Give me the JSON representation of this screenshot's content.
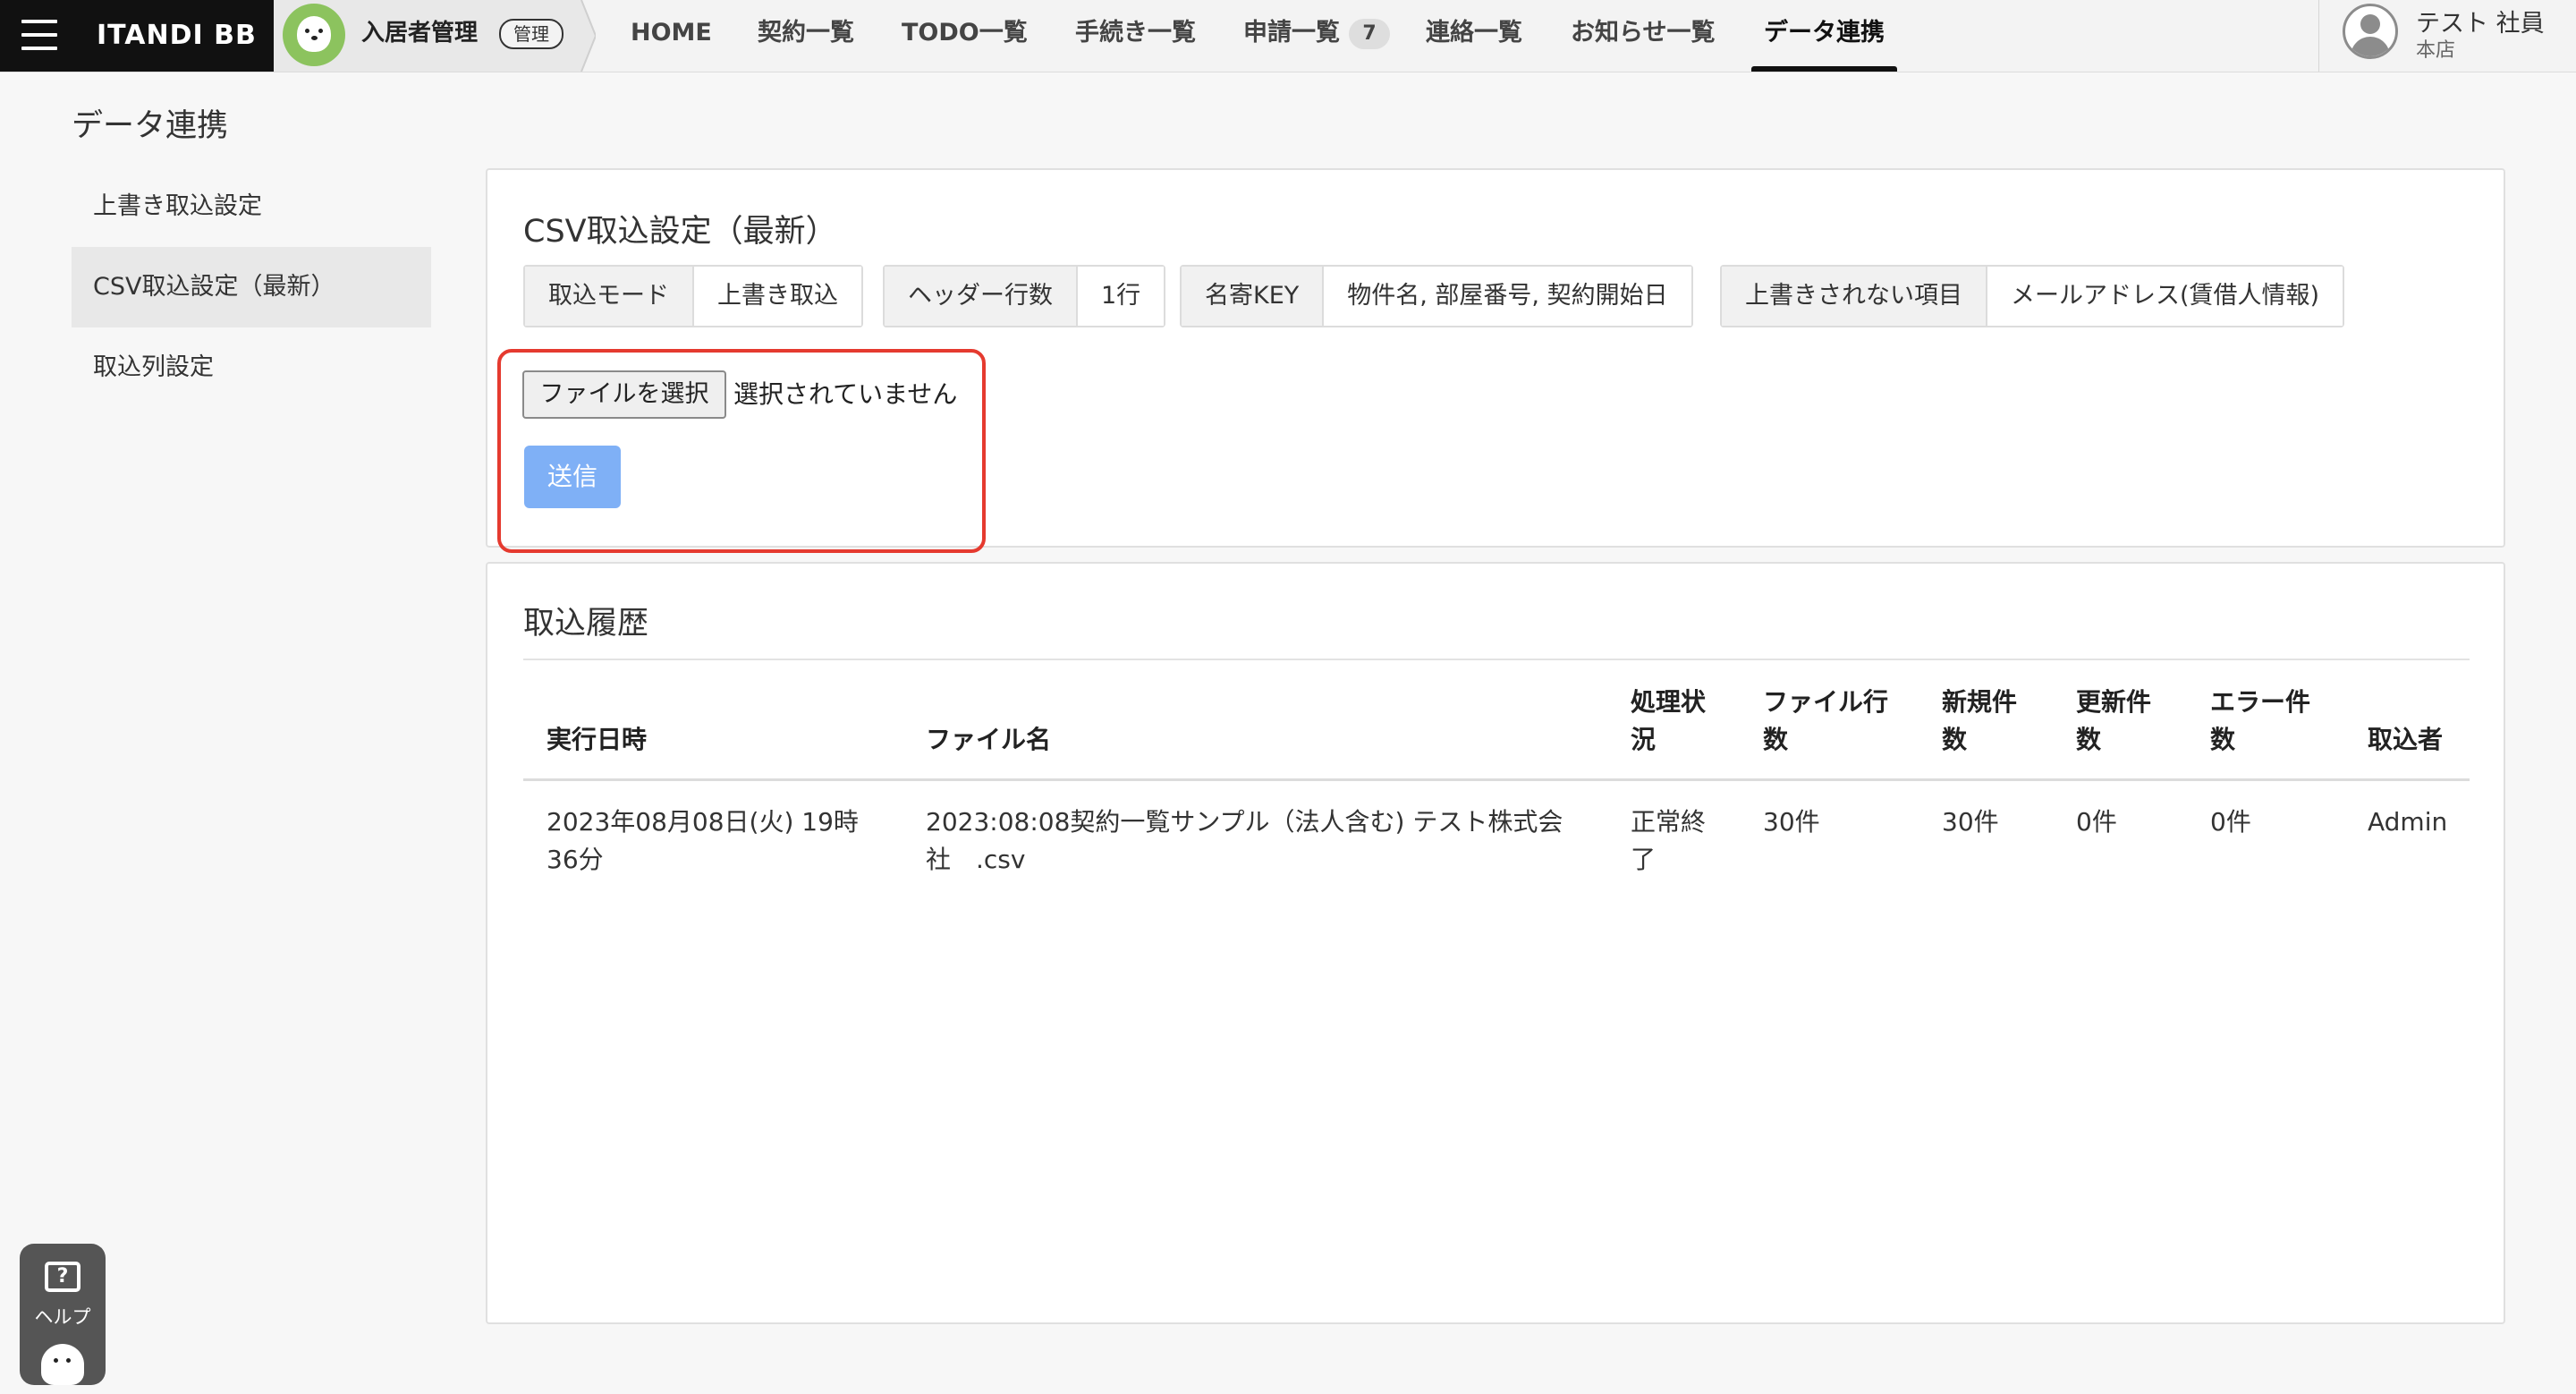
{
  "header": {
    "brand": "ITANDI BB",
    "product": {
      "name": "入居者管理",
      "badge": "管理"
    },
    "nav": [
      {
        "label": "HOME"
      },
      {
        "label": "契約一覧"
      },
      {
        "label": "TODO一覧"
      },
      {
        "label": "手続き一覧"
      },
      {
        "label": "申請一覧",
        "count": "7"
      },
      {
        "label": "連絡一覧"
      },
      {
        "label": "お知らせ一覧"
      },
      {
        "label": "データ連携",
        "active": true
      }
    ],
    "user": {
      "name": "テスト 社員",
      "branch": "本店"
    }
  },
  "page": {
    "title": "データ連携"
  },
  "sidebar": {
    "items": [
      {
        "label": "上書き取込設定"
      },
      {
        "label": "CSV取込設定（最新）",
        "active": true
      },
      {
        "label": "取込列設定"
      }
    ]
  },
  "csv_settings": {
    "title": "CSV取込設定（最新）",
    "tags": [
      {
        "key": "取込モード",
        "value": "上書き取込"
      },
      {
        "key": "ヘッダー行数",
        "value": "1行"
      },
      {
        "key": "名寄KEY",
        "value": "物件名, 部屋番号, 契約開始日"
      },
      {
        "key": "上書きされない項目",
        "value": "メールアドレス(賃借人情報)"
      }
    ],
    "file_button": "ファイルを選択",
    "file_status": "選択されていません",
    "submit": "送信",
    "highlight_color": "#e53a2f"
  },
  "history": {
    "title": "取込履歴",
    "columns": [
      "実行日時",
      "ファイル名",
      "処理状況",
      "ファイル行数",
      "新規件数",
      "更新件数",
      "エラー件数",
      "取込者"
    ],
    "rows": [
      {
        "date": "2023年08月08日(火) 19時36分",
        "file": "2023:08:08契約一覧サンプル（法人含む) テスト株式会社　.csv",
        "status": "正常終了",
        "lines": "30件",
        "new": "30件",
        "updated": "0件",
        "errors": "0件",
        "by": "Admin"
      }
    ]
  },
  "help": {
    "label": "ヘルプ"
  },
  "colors": {
    "brand_bg": "#111111",
    "submit_bg": "#7fb0f6",
    "avatar_green": "#8cc35e"
  }
}
